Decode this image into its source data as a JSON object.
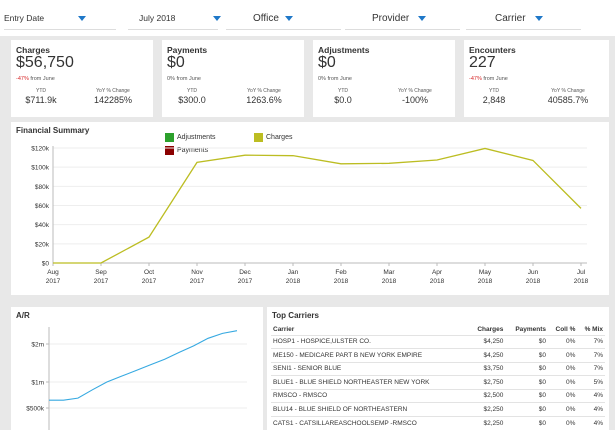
{
  "filters": [
    {
      "label": "Entry Date"
    },
    {
      "label": "July 2018"
    },
    {
      "label": "Office"
    },
    {
      "label": "Provider"
    },
    {
      "label": "Carrier"
    }
  ],
  "kpis": [
    {
      "title": "Charges",
      "value": "$56,750",
      "change_pct": "-47%",
      "change_text": " from June",
      "ytd_label": "YTD",
      "ytd": "$711.9k",
      "yoy_label": "YoY % Change",
      "yoy": "142285%"
    },
    {
      "title": "Payments",
      "value": "$0",
      "change_pct": "",
      "change_text": "0% from June",
      "ytd_label": "YTD",
      "ytd": "$300.0",
      "yoy_label": "YoY % Change",
      "yoy": "1263.6%"
    },
    {
      "title": "Adjustments",
      "value": "$0",
      "change_pct": "",
      "change_text": "0% from June",
      "ytd_label": "YTD",
      "ytd": "$0.0",
      "yoy_label": "YoY % Change",
      "yoy": "-100%"
    },
    {
      "title": "Encounters",
      "value": "227",
      "change_pct": "-47%",
      "change_text": " from June",
      "ytd_label": "YTD",
      "ytd": "2,848",
      "yoy_label": "YoY % Change",
      "yoy": "40585.7%"
    }
  ],
  "financial_summary": {
    "title": "Financial Summary",
    "legend": [
      {
        "name": "Adjustments",
        "color": "#2ca02c"
      },
      {
        "name": "Charges",
        "color": "#bcbd22"
      },
      {
        "name": "Payments",
        "color": "#8b0000"
      }
    ]
  },
  "ar": {
    "title": "A/R"
  },
  "top_carriers": {
    "title": "Top Carriers",
    "columns": [
      "Carrier",
      "Charges",
      "Payments",
      "Coll %",
      "% Mix"
    ],
    "rows": [
      [
        "HOSP1 - HOSPICE,ULSTER CO.",
        "$4,250",
        "$0",
        "0%",
        "7%"
      ],
      [
        "ME150 - MEDICARE PART B NEW YORK EMPIRE",
        "$4,250",
        "$0",
        "0%",
        "7%"
      ],
      [
        "SENI1 - SENIOR BLUE",
        "$3,750",
        "$0",
        "0%",
        "7%"
      ],
      [
        "BLUE1 - BLUE SHIELD NORTHEASTER NEW YORK",
        "$2,750",
        "$0",
        "0%",
        "5%"
      ],
      [
        "RMSCO - RMSCO",
        "$2,500",
        "$0",
        "0%",
        "4%"
      ],
      [
        "BLU14 - BLUE SHIELD OF NORTHEASTERN",
        "$2,250",
        "$0",
        "0%",
        "4%"
      ],
      [
        "CATS1 - CATSILLAREASCHOOLSEMP -RMSCO",
        "$2,250",
        "$0",
        "0%",
        "4%"
      ]
    ]
  },
  "chart_data": [
    {
      "type": "line",
      "title": "Financial Summary",
      "x": [
        "Aug 2017",
        "Sep 2017",
        "Oct 2017",
        "Nov 2017",
        "Dec 2017",
        "Jan 2018",
        "Feb 2018",
        "Mar 2018",
        "Apr 2018",
        "May 2018",
        "Jun 2018",
        "Jul 2018"
      ],
      "x_tick_month": [
        "Aug",
        "Sep",
        "Oct",
        "Nov",
        "Dec",
        "Jan",
        "Feb",
        "Mar",
        "Apr",
        "May",
        "Jun",
        "Jul"
      ],
      "x_tick_year": [
        "2017",
        "2017",
        "2017",
        "2017",
        "2017",
        "2018",
        "2018",
        "2018",
        "2018",
        "2018",
        "2018",
        "2018"
      ],
      "series": [
        {
          "name": "Charges",
          "color": "#bcbd22",
          "values": [
            0,
            0,
            27000,
            105000,
            112500,
            112000,
            103500,
            104000,
            107500,
            119500,
            107000,
            57000
          ]
        }
      ],
      "ylim": [
        0,
        120000
      ],
      "yticks": [
        0,
        20000,
        40000,
        60000,
        80000,
        100000,
        120000
      ],
      "ytick_labels": [
        "$0",
        "$20k",
        "$40k",
        "$60k",
        "$80k",
        "$100k",
        "$120k"
      ],
      "legend": [
        "Adjustments",
        "Charges",
        "Payments"
      ],
      "grid": true
    },
    {
      "type": "line",
      "title": "A/R",
      "series": [
        {
          "name": "",
          "color": "#36a9e1",
          "values": [
            650000,
            650000,
            690000,
            850000,
            1000000,
            1150000,
            1300000,
            1450000,
            1600000,
            1780000,
            1950000,
            2150000,
            2280000,
            2350000
          ]
        }
      ],
      "yticks": [
        500000,
        1000000,
        2000000
      ],
      "ytick_labels": [
        "$500k",
        "$1m",
        "$2m"
      ]
    }
  ]
}
